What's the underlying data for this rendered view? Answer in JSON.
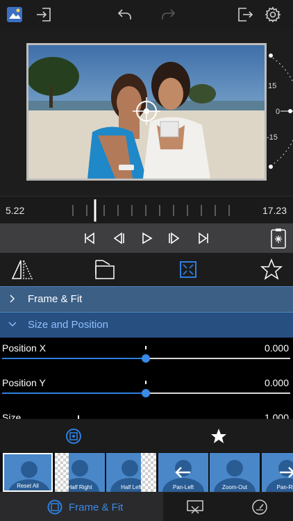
{
  "toolbar": {
    "icons": [
      "app-logo-icon",
      "import-icon",
      "undo-icon",
      "redo-icon",
      "export-icon",
      "gear-icon"
    ]
  },
  "dial": {
    "labels": [
      "15",
      "0",
      "-15"
    ]
  },
  "timeline": {
    "start": "5.22",
    "end": "17.23"
  },
  "transport": {
    "icons": [
      "skip-start-icon",
      "step-back-icon",
      "play-icon",
      "step-forward-icon",
      "skip-end-icon",
      "clipboard-icon"
    ]
  },
  "tools": {
    "icons": [
      "mirror-icon",
      "rotate-icon",
      "fit-icon",
      "star-icon"
    ]
  },
  "sections": {
    "frame_fit": "Frame & Fit",
    "size_position": "Size and Position"
  },
  "params": [
    {
      "name": "Position X",
      "value": "0.000",
      "level": 0.5
    },
    {
      "name": "Position Y",
      "value": "0.000",
      "level": 0.5
    },
    {
      "name": "Size",
      "value": "1.000",
      "level": 0.27
    }
  ],
  "presets": {
    "tabs": [
      "fit-icon",
      "star-icon"
    ],
    "items": [
      {
        "label": "Reset All"
      },
      {
        "label": "Half Right"
      },
      {
        "label": "Half Left"
      },
      {
        "label": "Pan-Left"
      },
      {
        "label": "Zoom-Out"
      },
      {
        "label": "Pan-Rig"
      }
    ]
  },
  "tabbar": {
    "active_label": "Frame & Fit",
    "icons": [
      "frame-fit-icon",
      "crop-icon",
      "speed-icon"
    ]
  },
  "colors": {
    "accent": "#2f7fe0",
    "section": "#2f6aa3"
  }
}
